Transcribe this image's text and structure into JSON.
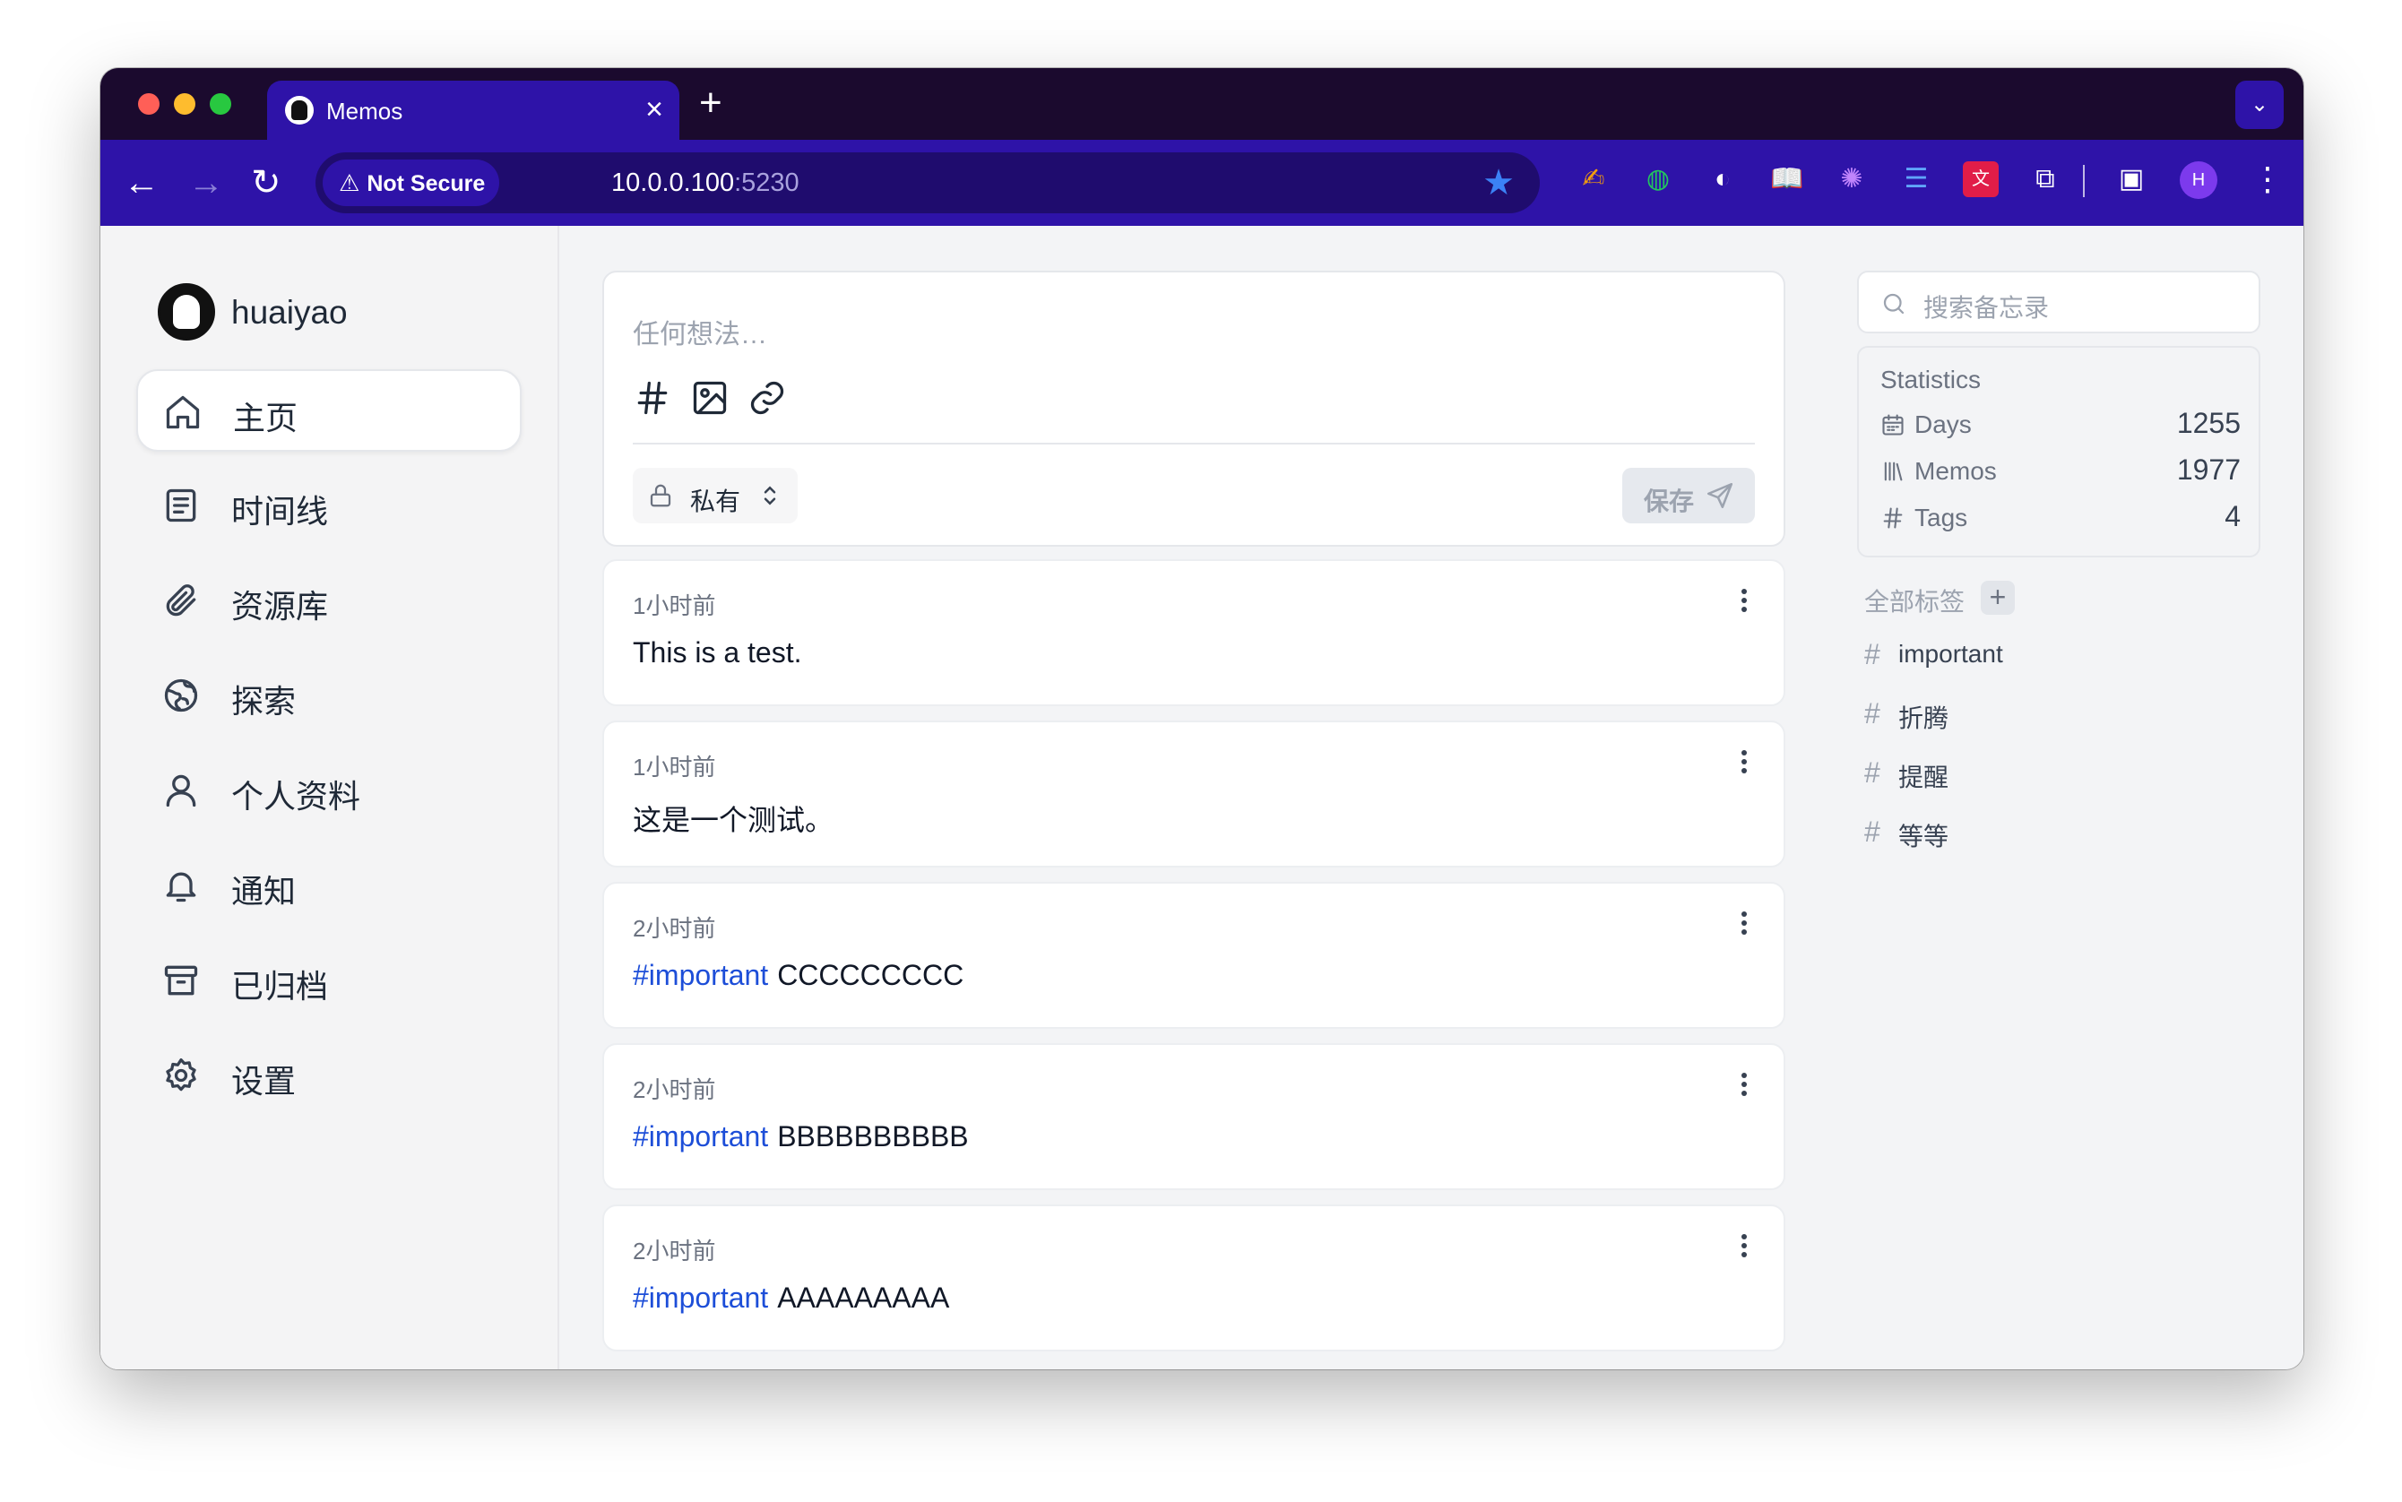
{
  "browser": {
    "tab_title": "Memos",
    "not_secure_label": "Not Secure",
    "url_host": "10.0.0.100",
    "url_port": ":5230",
    "profile_initial": "H"
  },
  "sidebar": {
    "username": "huaiyao",
    "items": [
      {
        "label": "主页",
        "icon": "home-icon"
      },
      {
        "label": "时间线",
        "icon": "timeline-icon"
      },
      {
        "label": "资源库",
        "icon": "paperclip-icon"
      },
      {
        "label": "探索",
        "icon": "globe-icon"
      },
      {
        "label": "个人资料",
        "icon": "user-icon"
      },
      {
        "label": "通知",
        "icon": "bell-icon"
      },
      {
        "label": "已归档",
        "icon": "archive-icon"
      },
      {
        "label": "设置",
        "icon": "gear-icon"
      }
    ]
  },
  "editor": {
    "placeholder": "任何想法…",
    "visibility": "私有",
    "save_label": "保存"
  },
  "memos": [
    {
      "time": "1小时前",
      "tag": "",
      "text": "This is a test."
    },
    {
      "time": "1小时前",
      "tag": "",
      "text": "这是一个测试。"
    },
    {
      "time": "2小时前",
      "tag": "#important",
      "text": "CCCCCCCCC"
    },
    {
      "time": "2小时前",
      "tag": "#important",
      "text": "BBBBBBBBBB"
    },
    {
      "time": "2小时前",
      "tag": "#important",
      "text": "AAAAAAAAA"
    }
  ],
  "search": {
    "placeholder": "搜索备忘录"
  },
  "statistics": {
    "title": "Statistics",
    "rows": [
      {
        "label": "Days",
        "value": "1255"
      },
      {
        "label": "Memos",
        "value": "1977"
      },
      {
        "label": "Tags",
        "value": "4"
      }
    ]
  },
  "tags": {
    "title": "全部标签",
    "items": [
      "important",
      "折腾",
      "提醒",
      "等等"
    ]
  },
  "colors": {
    "accent": "#2e13a8",
    "tag_link": "#1d4ed8"
  }
}
